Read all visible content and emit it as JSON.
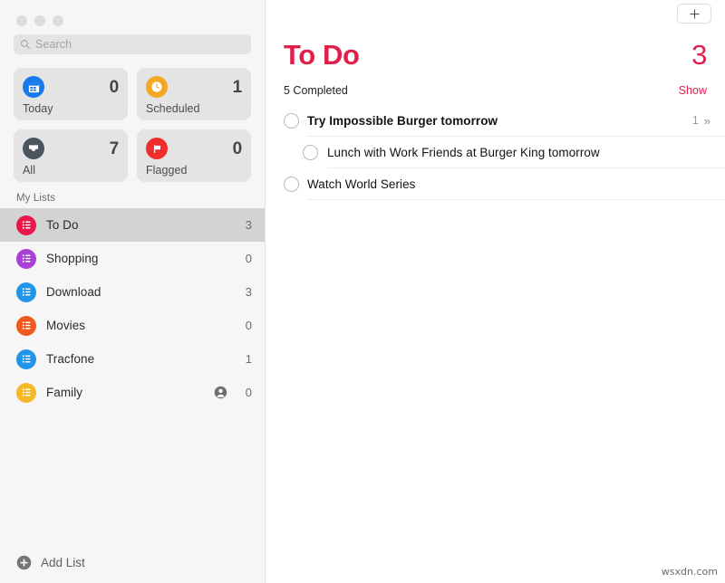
{
  "window": {
    "traffic_lights": [
      "close",
      "minimize",
      "zoom"
    ]
  },
  "sidebar": {
    "search": {
      "placeholder": "Search",
      "value": ""
    },
    "smart_lists": [
      {
        "name": "Today",
        "count": "0",
        "icon": "calendar-icon",
        "color": "#1879ed"
      },
      {
        "name": "Scheduled",
        "count": "1",
        "icon": "clock-icon",
        "color": "#f5a623"
      },
      {
        "name": "All",
        "count": "7",
        "icon": "inbox-icon",
        "color": "#4b5560"
      },
      {
        "name": "Flagged",
        "count": "0",
        "icon": "flag-icon",
        "color": "#f02c2c"
      }
    ],
    "section_title": "My Lists",
    "lists": [
      {
        "name": "To Do",
        "count": "3",
        "color": "#e8184a",
        "selected": true,
        "shared": false
      },
      {
        "name": "Shopping",
        "count": "0",
        "color": "#aa41d6",
        "selected": false,
        "shared": false
      },
      {
        "name": "Download",
        "count": "3",
        "color": "#2196e8",
        "selected": false,
        "shared": false
      },
      {
        "name": "Movies",
        "count": "0",
        "color": "#f2591f",
        "selected": false,
        "shared": false
      },
      {
        "name": "Tracfone",
        "count": "1",
        "color": "#2196e8",
        "selected": false,
        "shared": false
      },
      {
        "name": "Family",
        "count": "0",
        "color": "#f5b827",
        "selected": false,
        "shared": true
      }
    ],
    "add_list_label": "Add List"
  },
  "main": {
    "add_button_label": "+",
    "title": "To Do",
    "count": "3",
    "accent_color": "#e21e4b",
    "completed_text": "5 Completed",
    "show_label": "Show",
    "tasks": [
      {
        "text": "Try Impossible Burger tomorrow",
        "bold": true,
        "sub": false,
        "subtask_count": "1",
        "chevron": "»"
      },
      {
        "text": "Lunch with Work Friends at Burger King tomorrow",
        "bold": false,
        "sub": true,
        "subtask_count": "",
        "chevron": ""
      },
      {
        "text": "Watch World Series",
        "bold": false,
        "sub": false,
        "subtask_count": "",
        "chevron": ""
      }
    ]
  },
  "watermark": "wsxdn.com"
}
